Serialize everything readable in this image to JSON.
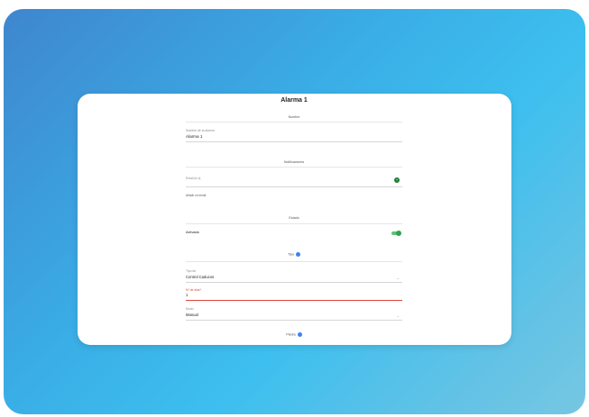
{
  "dialog": {
    "title": "Alarma 1"
  },
  "sections": {
    "nombre": "Nombre",
    "notificaciones": "Notificaciones",
    "estado": "Estado",
    "tipo": "Tipo",
    "piedra": "Piedra"
  },
  "name_field": {
    "label": "Nombre de la alarma",
    "value": "Alarma 1"
  },
  "notifications": {
    "email_label": "Email (e-s)",
    "add_hint": "Añadir un email"
  },
  "status": {
    "label": "Activada",
    "enabled": true
  },
  "type": {
    "category_label": "Tipo de",
    "category_value": "Control Caducos",
    "days_label": "Nº de días*",
    "days_value": "1",
    "mode_label": "Modo",
    "mode_value": "Manual"
  },
  "colors": {
    "accent_green": "#2ea44f",
    "info_blue": "#3b82f6",
    "error_red": "#e0473c"
  }
}
